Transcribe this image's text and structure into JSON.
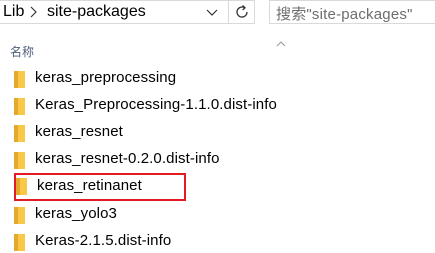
{
  "address_bar": {
    "crumbs": [
      {
        "label": "Lib"
      },
      {
        "label": "site-packages"
      }
    ]
  },
  "search": {
    "placeholder": "搜索\"site-packages\""
  },
  "columns": {
    "name_header": "名称"
  },
  "files": [
    {
      "name": "keras_preprocessing",
      "type": "folder",
      "selected": false
    },
    {
      "name": "Keras_Preprocessing-1.1.0.dist-info",
      "type": "folder",
      "selected": false
    },
    {
      "name": "keras_resnet",
      "type": "folder",
      "selected": false
    },
    {
      "name": "keras_resnet-0.2.0.dist-info",
      "type": "folder",
      "selected": false
    },
    {
      "name": "keras_retinanet",
      "type": "folder",
      "selected": true
    },
    {
      "name": "keras_yolo3",
      "type": "folder",
      "selected": false
    },
    {
      "name": "Keras-2.1.5.dist-info",
      "type": "folder",
      "selected": false
    }
  ],
  "colors": {
    "folder": "#f8c846",
    "highlight_border": "#e51b23",
    "header_text": "#4c607a"
  }
}
